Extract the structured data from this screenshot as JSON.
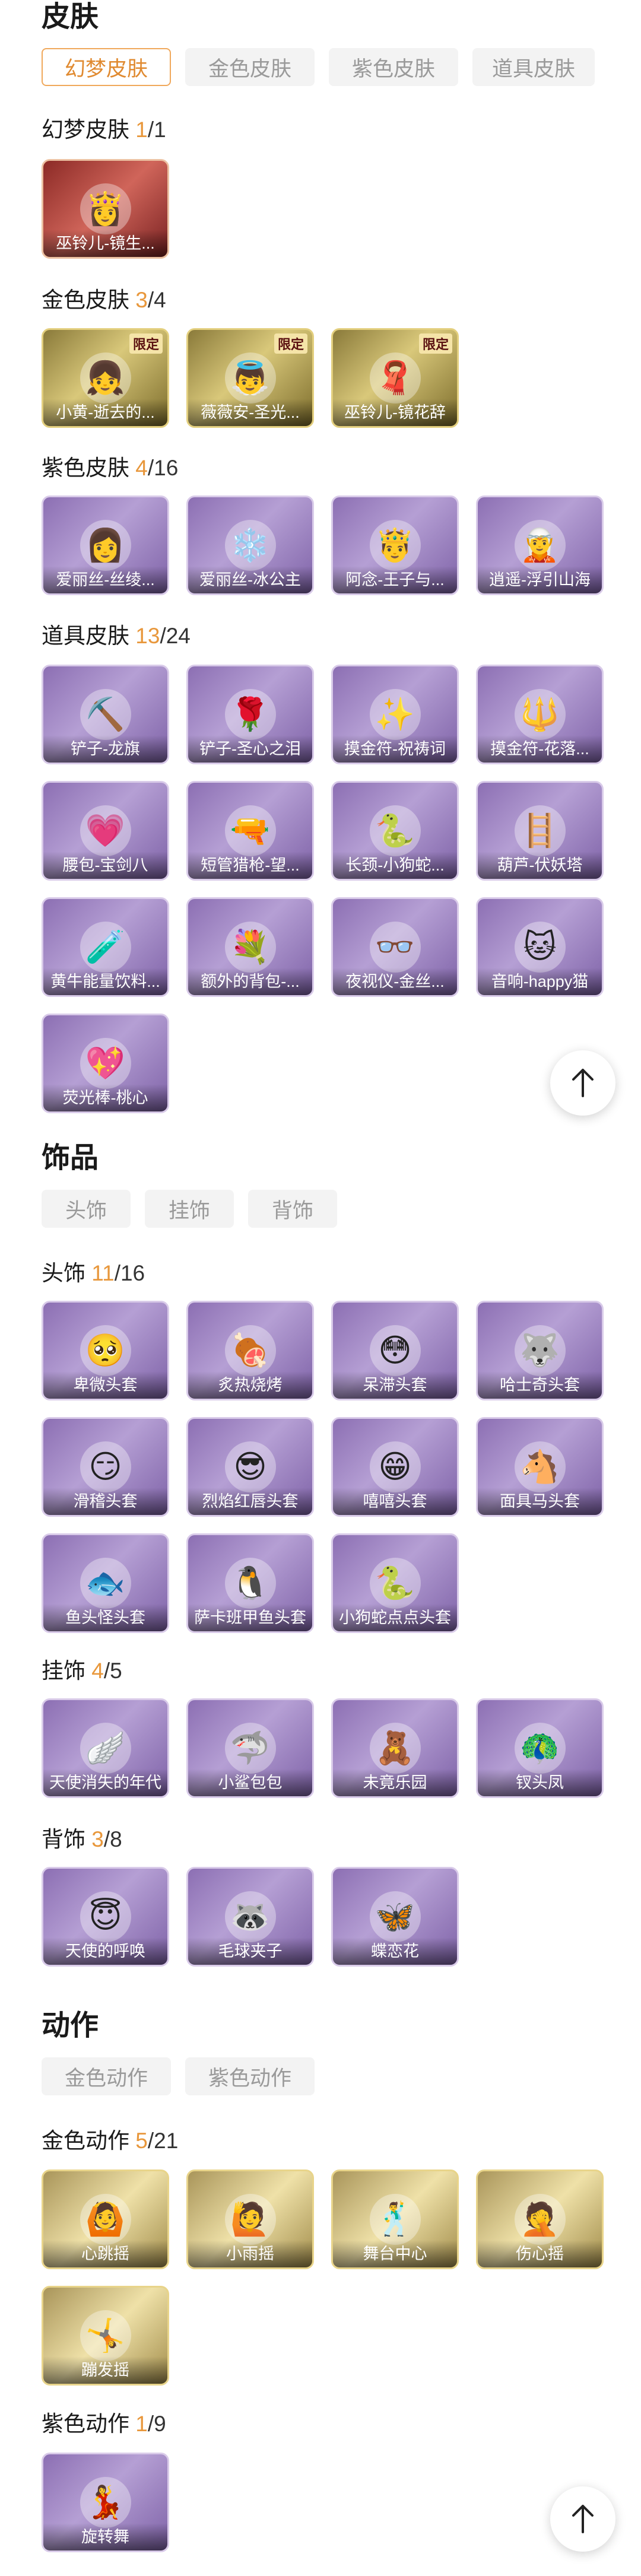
{
  "skins": {
    "title": "皮肤",
    "tabs": [
      "幻梦皮肤",
      "金色皮肤",
      "紫色皮肤",
      "道具皮肤"
    ],
    "dream": {
      "title": "幻梦皮肤",
      "owned": "1",
      "total": "/1",
      "items": [
        "巫铃儿-镜生..."
      ]
    },
    "gold": {
      "title": "金色皮肤",
      "owned": "3",
      "total": "/4",
      "limited": "限定",
      "items": [
        "小黄-逝去的...",
        "薇薇安-圣光...",
        "巫铃儿-镜花辞"
      ]
    },
    "purple": {
      "title": "紫色皮肤",
      "owned": "4",
      "total": "/16",
      "items": [
        "爱丽丝-丝绫...",
        "爱丽丝-冰公主",
        "阿念-王子与...",
        "逍遥-浮引山海"
      ]
    },
    "prop": {
      "title": "道具皮肤",
      "owned": "13",
      "total": "/24",
      "items": [
        "铲子-龙旗",
        "铲子-圣心之泪",
        "摸金符-祝祷词",
        "摸金符-花落...",
        "腰包-宝剑八",
        "短管猎枪-望...",
        "长颈-小狗蛇...",
        "葫芦-伏妖塔",
        "黄牛能量饮料...",
        "额外的背包-...",
        "夜视仪-金丝...",
        "音响-happy猫",
        "荧光棒-桃心"
      ]
    }
  },
  "accessories": {
    "title": "饰品",
    "tabs": [
      "头饰",
      "挂饰",
      "背饰"
    ],
    "head": {
      "title": "头饰",
      "owned": "11",
      "total": "/16",
      "items": [
        "卑微头套",
        "炙热烧烤",
        "呆滞头套",
        "哈士奇头套",
        "滑稽头套",
        "烈焰红唇头套",
        "嘻嘻头套",
        "面具马头套",
        "鱼头怪头套",
        "萨卡班甲鱼头套",
        "小狗蛇点点头套"
      ]
    },
    "hang": {
      "title": "挂饰",
      "owned": "4",
      "total": "/5",
      "items": [
        "天使消失的年代",
        "小鲨包包",
        "未竟乐园",
        "钗头凤"
      ]
    },
    "back": {
      "title": "背饰",
      "owned": "3",
      "total": "/8",
      "items": [
        "天使的呼唤",
        "毛球夹子",
        "蝶恋花"
      ]
    }
  },
  "actions": {
    "title": "动作",
    "tabs": [
      "金色动作",
      "紫色动作"
    ],
    "gold": {
      "title": "金色动作",
      "owned": "5",
      "total": "/21",
      "items": [
        "心跳摇",
        "小雨摇",
        "舞台中心",
        "伤心摇",
        "蹦发摇"
      ]
    },
    "purple": {
      "title": "紫色动作",
      "owned": "1",
      "total": "/9",
      "items": [
        "旋转舞"
      ]
    }
  },
  "scroll_top_icon": "arrow-up-icon",
  "colors": {
    "accent": "#e8973b",
    "purple_card": "#8c6fb3",
    "gold_card": "#d9c87a"
  }
}
